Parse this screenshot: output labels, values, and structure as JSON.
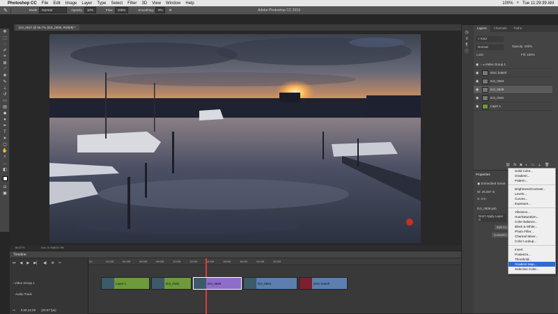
{
  "menubar": {
    "app": "Photoshop CC",
    "items": [
      "File",
      "Edit",
      "Image",
      "Layer",
      "Type",
      "Select",
      "Filter",
      "3D",
      "View",
      "Window",
      "Help"
    ],
    "battery": "100%",
    "clock": "Tue 11:29:39 AM"
  },
  "window_title": "Adobe Photoshop CC 2019",
  "options_bar": {
    "mode_label": "Mode:",
    "mode_value": "Normal",
    "opacity_label": "Opacity:",
    "opacity_value": "10%",
    "flow_label": "Flow:",
    "flow_value": "100%",
    "smoothing_label": "Smoothing:",
    "smoothing_value": "0%"
  },
  "document_tab": "DJI_0027 @ 66.7% (DJI_0839, RGB/8) *",
  "status": {
    "zoom": "66.67%",
    "doc": "Doc: 5.93M/29.7M"
  },
  "timeline": {
    "title": "Timeline",
    "ruler": [
      "00",
      "02:00f",
      "04:00f",
      "06:00f",
      "08:00f",
      "10:00f",
      "12:00f",
      "14:00f",
      "16:00f",
      "18:00f",
      "20:00f",
      "22:00f"
    ],
    "video_group": "Video Group 1",
    "audio_track": "Audio Track",
    "timecode": "0;00;12;09",
    "fps": "(29.97 fps)",
    "clips": [
      {
        "label": "Layer 1",
        "color": "#6d9a3a"
      },
      {
        "label": "DJI_0181",
        "color": "#6d9a3a"
      },
      {
        "label": "DJI_0839",
        "color": "#8e6cc9"
      },
      {
        "label": "DJI_0064",
        "color": "#5c7fb0"
      },
      {
        "label": "EGC bokeh",
        "color": "#5c7fb0"
      }
    ]
  },
  "layers_panel": {
    "tabs": [
      "Layers",
      "Channels",
      "Paths"
    ],
    "filter": "Kind",
    "blend": "Normal",
    "opacity_label": "Opacity:",
    "opacity_value": "100%",
    "lock_label": "Lock:",
    "fill_label": "Fill:",
    "fill_value": "100%",
    "rows": [
      "Video Group 1",
      "EGC bokeh",
      "DJI_0064",
      "DJI_0839",
      "DJI_0181",
      "Layer 1"
    ]
  },
  "properties_panel": {
    "title": "Properties",
    "subtitle": "Embedded Smart",
    "w_label": "W:",
    "w_value": "26.667 in",
    "x_label": "X:",
    "x_value": "0 in",
    "file": "DJI_0839.psb",
    "comp": "Don't Apply Layer C",
    "edit_btn": "Edit Co",
    "convert_btn": "Convert t"
  },
  "adjustment_menu": {
    "group1": [
      "Solid Color...",
      "Gradient...",
      "Pattern..."
    ],
    "group2": [
      "Brightness/Contrast...",
      "Levels...",
      "Curves...",
      "Exposure..."
    ],
    "group3": [
      "Vibrance...",
      "Hue/Saturation...",
      "Color Balance...",
      "Black & White...",
      "Photo Filter...",
      "Channel Mixer...",
      "Color Lookup..."
    ],
    "group4": [
      "Invert",
      "Posterize...",
      "Threshold...",
      "Gradient Map...",
      "Selective Color..."
    ],
    "selected": "Gradient Map..."
  }
}
